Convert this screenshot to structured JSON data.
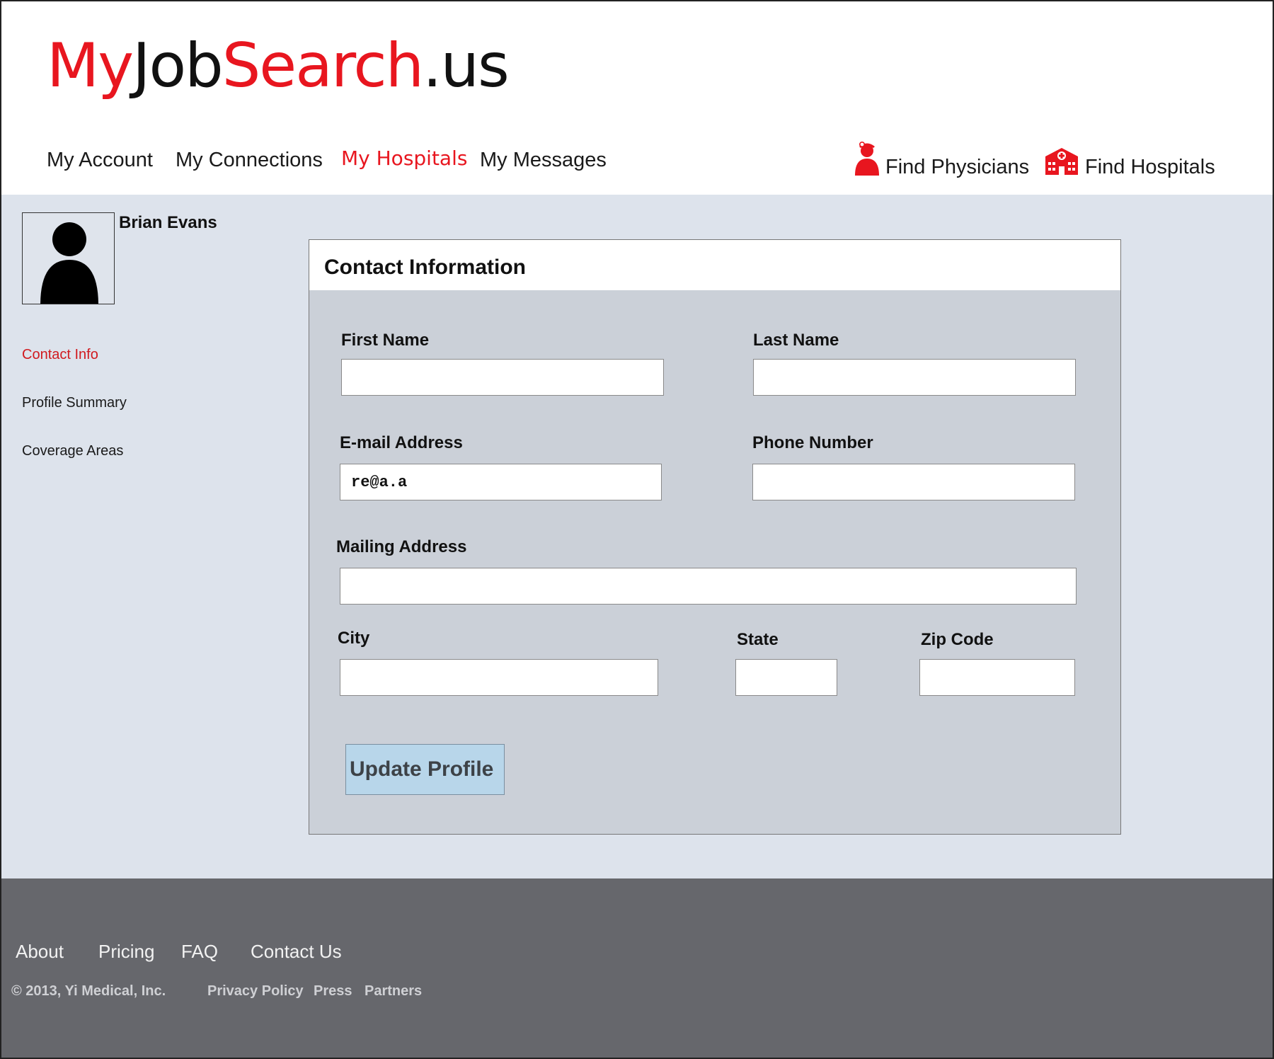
{
  "logo": {
    "part1": "My",
    "part2": "Job",
    "part3": "Search",
    "part4": ".us"
  },
  "nav": {
    "items": [
      {
        "label": "My Account"
      },
      {
        "label": "My Connections"
      },
      {
        "label": "My Hospitals",
        "active": true
      },
      {
        "label": "My Messages"
      }
    ],
    "find_physicians": "Find Physicians",
    "find_hospitals": "Find Hospitals",
    "physician_icon": "physician-icon",
    "hospital_icon": "hospital-icon"
  },
  "user": {
    "name": "Brian Evans",
    "avatar_icon": "avatar-placeholder-icon"
  },
  "sidebar": {
    "items": [
      {
        "label": "Contact Info",
        "active": true
      },
      {
        "label": "Profile Summary"
      },
      {
        "label": "Coverage Areas"
      }
    ]
  },
  "form": {
    "title": "Contact Information",
    "first_name": {
      "label": "First Name",
      "value": ""
    },
    "last_name": {
      "label": "Last Name",
      "value": ""
    },
    "email": {
      "label": "E-mail Address",
      "value": "re@a.a"
    },
    "phone": {
      "label": "Phone Number",
      "value": ""
    },
    "mailing_address": {
      "label": "Mailing Address",
      "value": ""
    },
    "city": {
      "label": "City",
      "value": ""
    },
    "state": {
      "label": "State",
      "value": ""
    },
    "zip": {
      "label": "Zip Code",
      "value": ""
    },
    "submit_label": "Update Profile"
  },
  "footer": {
    "links": [
      "About",
      "Pricing",
      "FAQ",
      "Contact Us"
    ],
    "copyright": "© 2013, Yi Medical, Inc.",
    "sub_links": [
      "Privacy Policy",
      "Press",
      "Partners"
    ]
  },
  "colors": {
    "brand_red": "#e8161f",
    "content_bg": "#dde3ec",
    "card_bg": "#cbd0d8",
    "footer_bg": "#66676c",
    "button_bg": "#b8d6ea"
  }
}
